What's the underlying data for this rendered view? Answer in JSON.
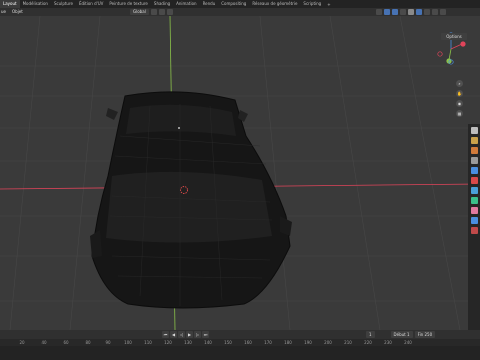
{
  "workspace_tabs": [
    {
      "label": "Layout",
      "active": true
    },
    {
      "label": "Modélisation",
      "active": false
    },
    {
      "label": "Sculpture",
      "active": false
    },
    {
      "label": "Édition d'UV",
      "active": false
    },
    {
      "label": "Peinture de texture",
      "active": false
    },
    {
      "label": "Shading",
      "active": false
    },
    {
      "label": "Animation",
      "active": false
    },
    {
      "label": "Rendu",
      "active": false
    },
    {
      "label": "Compositing",
      "active": false
    },
    {
      "label": "Réseaux de géométrie",
      "active": false
    },
    {
      "label": "Scripting",
      "active": false
    }
  ],
  "add_tab_label": "+",
  "header": {
    "mode_label": "ue",
    "object_menu": "Objet",
    "orientation_label": "Global",
    "pivot_icon": "pivot-icon"
  },
  "viewport": {
    "options_label": "Options",
    "axis_colors": {
      "x": "#e0445a",
      "y": "#8bc34a",
      "z": "#4a8fe0"
    },
    "subject": "car-mesh"
  },
  "property_tab_colors": [
    "#bdbdbd",
    "#c9a14a",
    "#d07a3a",
    "#9a9a9a",
    "#4a8fe0",
    "#d84a4a",
    "#4aa0d8",
    "#3ac08a",
    "#e07aa0",
    "#4a8fe0",
    "#c04a4a"
  ],
  "timeline": {
    "start_frame_label": "Début",
    "start_frame": "1",
    "end_frame_label": "Fin",
    "end_frame": "250",
    "current_frame": "1",
    "ruler_ticks": [
      "20",
      "40",
      "60",
      "80",
      "90",
      "100",
      "110",
      "120",
      "130",
      "140",
      "150",
      "160",
      "170",
      "180",
      "190",
      "200",
      "210",
      "220",
      "230",
      "240"
    ]
  }
}
